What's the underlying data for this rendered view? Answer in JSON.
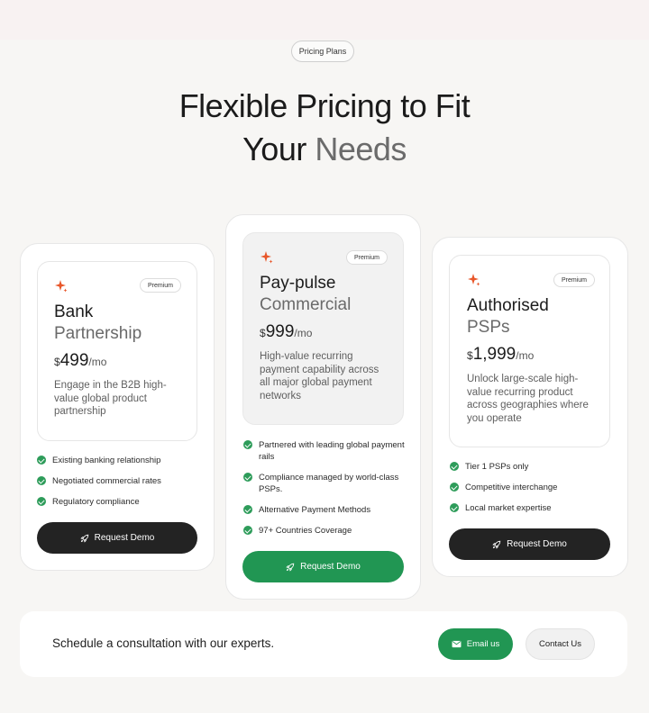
{
  "header": {
    "pill": "Pricing Plans",
    "title_line1": "Flexible Pricing to Fit",
    "title_line2_a": "Your ",
    "title_line2_b": "Needs"
  },
  "plans": [
    {
      "badge": "Premium",
      "title": "Bank",
      "subtitle": "Partnership",
      "currency": "$",
      "amount": "499",
      "period": "/mo",
      "description": "Engage in the B2B high-value global product partnership",
      "features": [
        "Existing banking relationship",
        "Negotiated commercial rates",
        "Regulatory compliance"
      ],
      "button": "Request Demo"
    },
    {
      "badge": "Premium",
      "title": "Pay-pulse",
      "subtitle": "Commercial",
      "currency": "$",
      "amount": "999",
      "period": "/mo",
      "description": "High-value recurring payment capability across all major global payment networks",
      "features": [
        "Partnered with leading global payment rails",
        "Compliance managed by world-class PSPs.",
        "Alternative Payment Methods",
        "97+ Countries Coverage"
      ],
      "button": "Request Demo"
    },
    {
      "badge": "Premium",
      "title": "Authorised",
      "subtitle": "PSPs",
      "currency": "$",
      "amount": "1,999",
      "period": "/mo",
      "description": "Unlock large-scale high-value recurring product across geographies where you operate",
      "features": [
        "Tier 1 PSPs only",
        "Competitive interchange",
        "Local market expertise"
      ],
      "button": "Request Demo"
    }
  ],
  "cta": {
    "text": "Schedule a consultation with our experts.",
    "email_label": "Email us",
    "contact_label": "Contact Us"
  },
  "colors": {
    "accent_green": "#219653",
    "dark_button": "#232323",
    "spark_orange": "#e8572a"
  },
  "icons": {
    "spark": "sparkle-icon",
    "check": "check-circle-icon",
    "rocket": "rocket-icon",
    "email": "email-icon"
  }
}
